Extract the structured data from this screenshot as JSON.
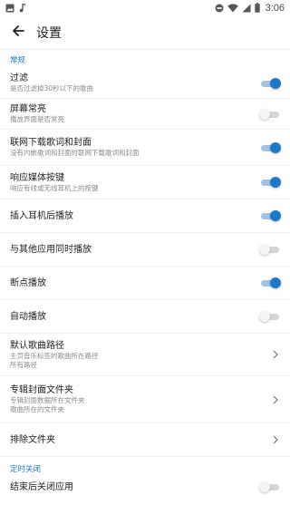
{
  "status_bar": {
    "time": "3:06",
    "left_icons": [
      "photo-icon",
      "music-note-icon"
    ],
    "right_icons": [
      "do-not-disturb-icon",
      "wifi-icon",
      "cell-signal-icon",
      "battery-icon"
    ]
  },
  "toolbar": {
    "title": "设置",
    "back_icon": "arrow-left-icon"
  },
  "sections": [
    {
      "header": "常规",
      "items": [
        {
          "title": "过滤",
          "subtitle": "是否过滤掉30秒以下的歌曲",
          "switch": true
        },
        {
          "title": "屏幕常亮",
          "subtitle": "播放界面是否常亮",
          "switch": false
        },
        {
          "title": "联网下载歌词和封面",
          "subtitle": "没有内嵌歌词和封面时联网下载歌词和封面",
          "switch": true
        },
        {
          "title": "响应媒体按键",
          "subtitle": "响应有线或无线耳机上的按键",
          "switch": true
        },
        {
          "title": "插入耳机后播放",
          "switch": true
        },
        {
          "title": "与其他应用同时播放",
          "switch": false
        },
        {
          "title": "断点播放",
          "switch": true
        },
        {
          "title": "自动播放",
          "switch": false
        },
        {
          "title": "默认歌曲路径",
          "subtitle": "主页音乐标签的歌曲所在路径",
          "subtitle2": "所有路径"
        },
        {
          "title": "专辑封面文件夹",
          "subtitle": "专辑封面数据所在文件夹",
          "subtitle2": "歌曲所在的文件夹"
        },
        {
          "title": "排除文件夹"
        }
      ]
    },
    {
      "header": "定时关闭",
      "items": [
        {
          "title": "结束后关闭应用",
          "switch": false
        }
      ]
    }
  ],
  "colors": {
    "accent": "#1e78c8",
    "accent_track": "#9fc3e6",
    "off_track": "#d6d6d6"
  }
}
